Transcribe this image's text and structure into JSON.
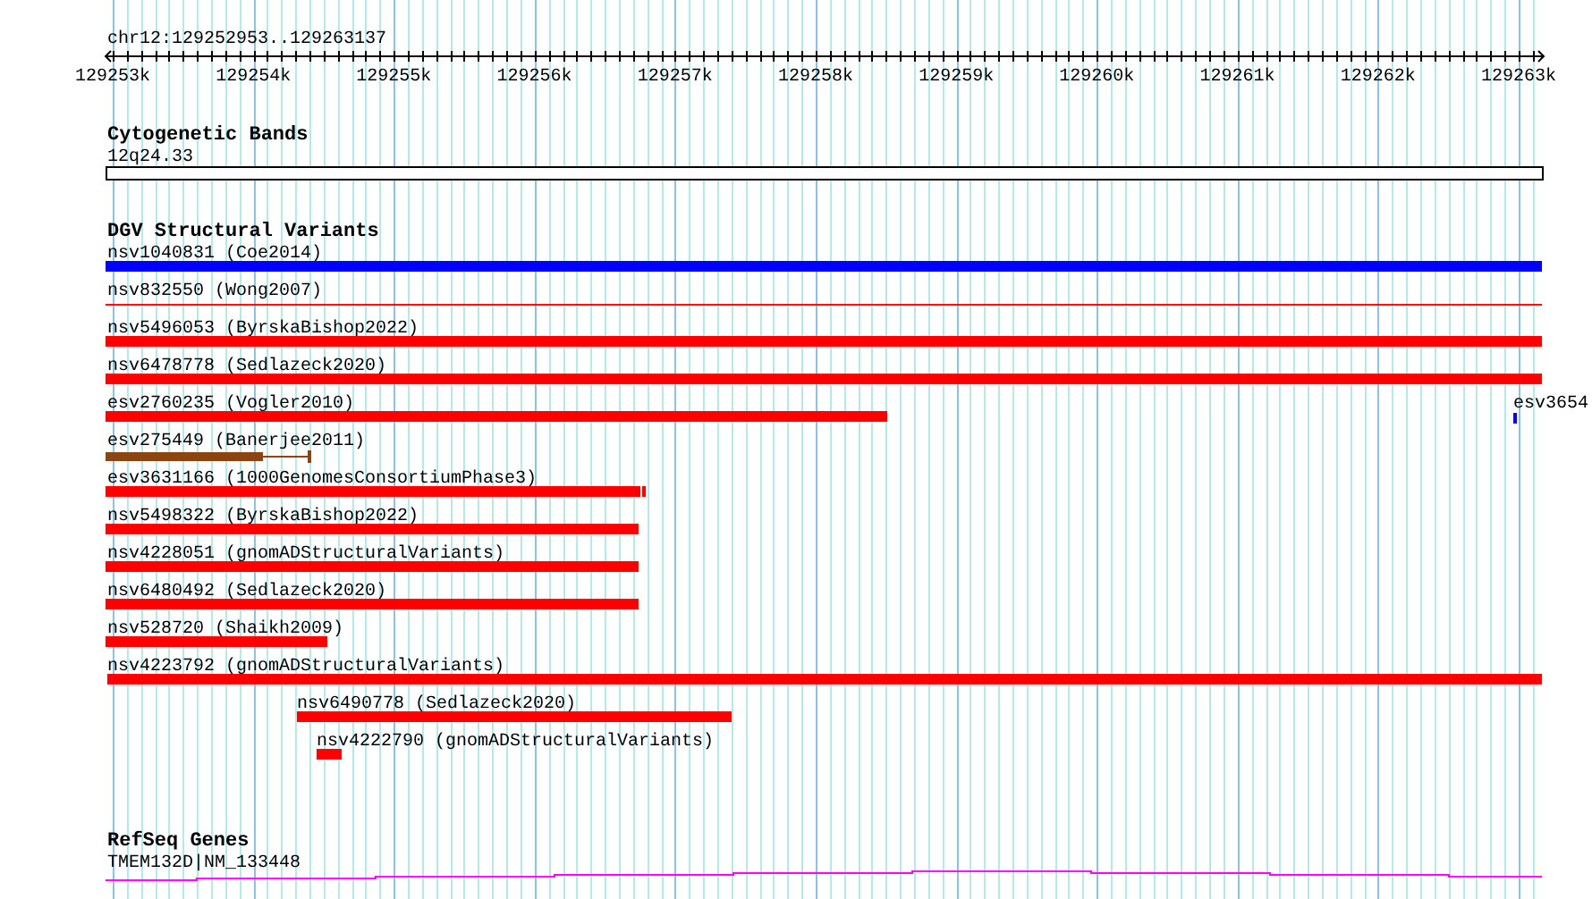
{
  "ruler": {
    "location": "chr12:129252953..129263137",
    "tick_labels": [
      "129253k",
      "129254k",
      "129255k",
      "129256k",
      "129257k",
      "129258k",
      "129259k",
      "129260k",
      "129261k",
      "129262k",
      "129263k"
    ]
  },
  "tracks": [
    {
      "kind": "bands",
      "title": "Cytogenetic Bands",
      "features": [
        {
          "label": "12q24.33"
        }
      ]
    },
    {
      "kind": "variants",
      "title": "DGV Structural Variants",
      "features": [
        {
          "label": "nsv1040831 (Coe2014)",
          "color": "#0000ff"
        },
        {
          "label": "nsv832550 (Wong2007)",
          "color": "#ff0000"
        },
        {
          "label": "nsv5496053 (ByrskaBishop2022)",
          "color": "#ff0000"
        },
        {
          "label": "nsv6478778 (Sedlazeck2020)",
          "color": "#ff0000"
        },
        {
          "label": "esv2760235 (Vogler2010)",
          "color": "#ff0000"
        },
        {
          "label": "esv3654",
          "color": "#0000ff"
        },
        {
          "label": "esv275449 (Banerjee2011)",
          "color": "#8b4513"
        },
        {
          "label": "esv3631166 (1000GenomesConsortiumPhase3)",
          "color": "#ff0000"
        },
        {
          "label": "nsv5498322 (ByrskaBishop2022)",
          "color": "#ff0000"
        },
        {
          "label": "nsv4228051 (gnomADStructuralVariants)",
          "color": "#ff0000"
        },
        {
          "label": "nsv6480492 (Sedlazeck2020)",
          "color": "#ff0000"
        },
        {
          "label": "nsv528720 (Shaikh2009)",
          "color": "#ff0000"
        },
        {
          "label": "nsv4223792 (gnomADStructuralVariants)",
          "color": "#ff0000"
        },
        {
          "label": "nsv6490778 (Sedlazeck2020)",
          "color": "#ff0000"
        },
        {
          "label": "nsv4222790 (gnomADStructuralVariants)",
          "color": "#ff0000"
        }
      ]
    },
    {
      "kind": "genes",
      "title": "RefSeq Genes",
      "features": [
        {
          "label": "TMEM132D|NM_133448"
        }
      ]
    }
  ]
}
